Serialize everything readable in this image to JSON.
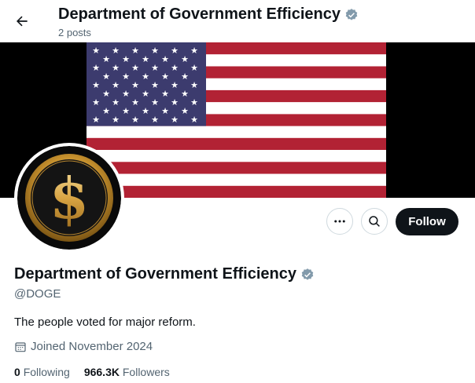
{
  "header": {
    "title": "Department of Government Efficiency",
    "posts": "2 posts",
    "back_icon": "arrow-left-icon"
  },
  "banner": {
    "image": "american-flag",
    "colors": {
      "red": "#b22234",
      "blue": "#3c3b6e",
      "white": "#ffffff"
    }
  },
  "avatar": {
    "symbol": "$",
    "colors": {
      "gold": "#d4a33c",
      "background": "#111111"
    }
  },
  "actions": {
    "more_icon": "more-horizontal-icon",
    "search_icon": "search-icon",
    "follow_label": "Follow"
  },
  "profile": {
    "name": "Department of Government Efficiency",
    "handle": "@DOGE",
    "bio": "The people voted for major reform.",
    "joined": "Joined November 2024",
    "verified_color": "#829aab"
  },
  "stats": {
    "following_count": "0",
    "following_label": "Following",
    "followers_count": "966.3K",
    "followers_label": "Followers"
  }
}
